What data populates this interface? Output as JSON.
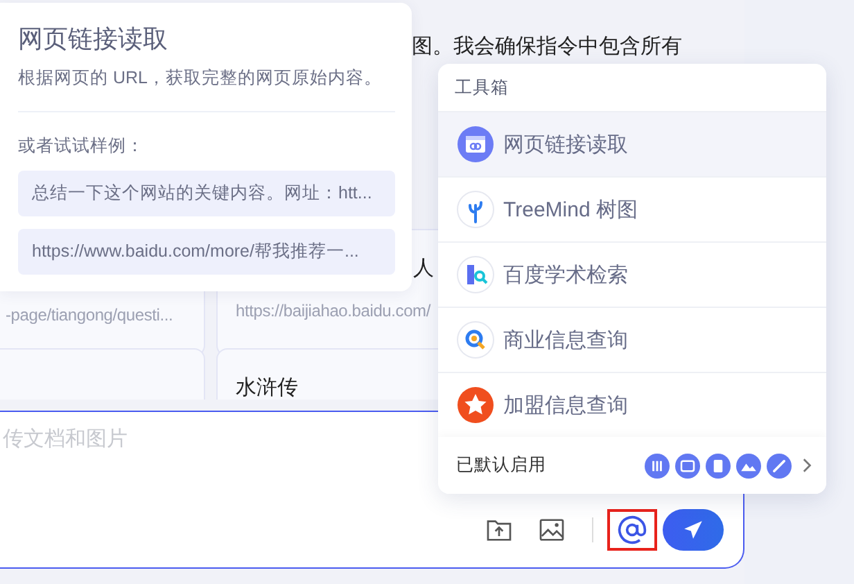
{
  "chat": {
    "message_fragment": "图。我会确保指令中包含所有"
  },
  "cards": [
    {
      "url": "-page/tiangong/questi..."
    },
    {
      "title": "人",
      "url": "https://baijiahao.baidu.com/"
    },
    {
      "title": "水浒传"
    }
  ],
  "input": {
    "placeholder": "传文档和图片"
  },
  "tool_detail": {
    "title": "网页链接读取",
    "description": "根据网页的 URL，获取完整的网页原始内容。",
    "examples_label": "或者试试样例：",
    "examples": [
      "总结一下这个网站的关键内容。网址：htt...",
      "https://www.baidu.com/more/帮我推荐一..."
    ]
  },
  "toolbox": {
    "title": "工具箱",
    "items": [
      {
        "label": "网页链接读取",
        "selected": true
      },
      {
        "label": "TreeMind 树图",
        "selected": false
      },
      {
        "label": "百度学术检索",
        "selected": false
      },
      {
        "label": "商业信息查询",
        "selected": false
      },
      {
        "label": "加盟信息查询",
        "selected": false
      }
    ],
    "footer_label": "已默认启用"
  }
}
